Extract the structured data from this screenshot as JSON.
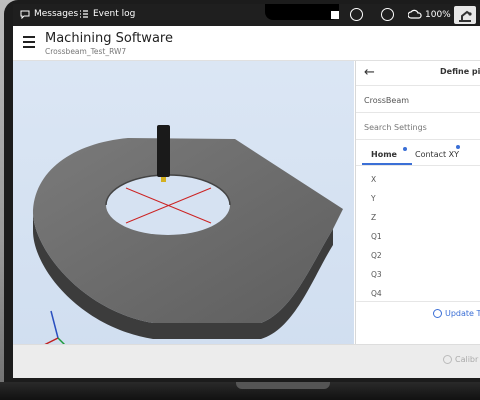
{
  "statusbar": {
    "messages_label": "Messages",
    "event_log_label": "Event log",
    "battery_percent": "100%"
  },
  "header": {
    "title": "Machining Software",
    "subtitle": "Crossbeam_Test_RW7"
  },
  "panel": {
    "title": "Define pin",
    "module_field": "CrossBeam",
    "search_placeholder": "Search Settings",
    "tabs": [
      {
        "label": "Home",
        "active": true
      },
      {
        "label": "Contact XY",
        "active": false
      }
    ],
    "axes": [
      "X",
      "Y",
      "Z",
      "Q1",
      "Q2",
      "Q3",
      "Q4"
    ],
    "update_button": "Update T"
  },
  "footer": {
    "calibrate_button": "Calibr"
  },
  "colors": {
    "accent": "#3b6fd6",
    "statusbar": "#1f1f1f",
    "viewport_bg": "#d6e2f2",
    "part_gray": "#6a6a6a"
  }
}
